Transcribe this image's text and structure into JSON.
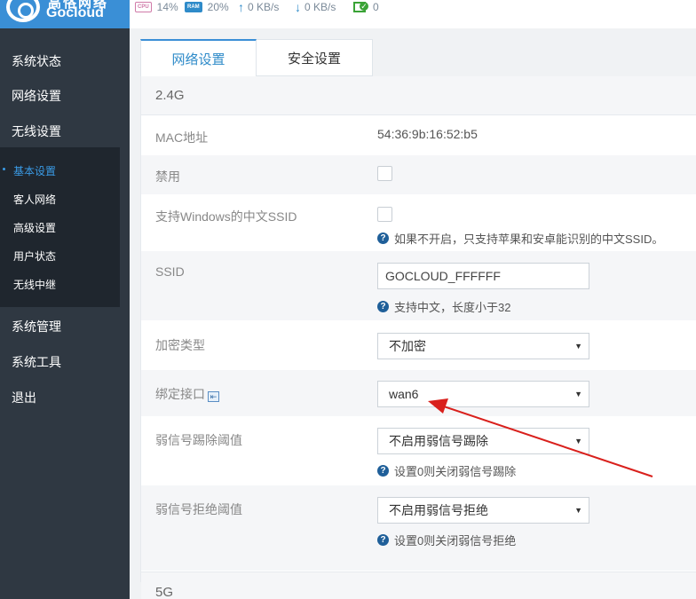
{
  "logo": {
    "cn": "高恪网络",
    "en": "Gocloud"
  },
  "status": {
    "cpu_chip": "CPU",
    "cpu": "14%",
    "ram_chip": "RAM",
    "ram": "20%",
    "up": "0 KB/s",
    "down": "0 KB/s",
    "devices": "0"
  },
  "sidebar": {
    "items": [
      "系统状态",
      "网络设置",
      "无线设置"
    ],
    "submenu": [
      "基本设置",
      "客人网络",
      "高级设置",
      "用户状态",
      "无线中继"
    ],
    "items_after": [
      "系统管理",
      "系统工具",
      "退出"
    ]
  },
  "tabs": [
    "网络设置",
    "安全设置"
  ],
  "form": {
    "section_24g": "2.4G",
    "mac_label": "MAC地址",
    "mac_value": "54:36:9b:16:52:b5",
    "disable_label": "禁用",
    "cn_ssid_label": "支持Windows的中文SSID",
    "cn_ssid_hint": "如果不开启，只支持苹果和安卓能识别的中文SSID。",
    "ssid_label": "SSID",
    "ssid_value": "GOCLOUD_FFFFFF",
    "ssid_hint": "支持中文，长度小于32",
    "encrypt_label": "加密类型",
    "encrypt_value": "不加密",
    "bind_label": "绑定接口",
    "bind_value": "wan6",
    "weak_kick_label": "弱信号踢除阈值",
    "weak_kick_value": "不启用弱信号踢除",
    "weak_kick_hint": "设置0则关闭弱信号踢除",
    "weak_reject_label": "弱信号拒绝阈值",
    "weak_reject_value": "不启用弱信号拒绝",
    "weak_reject_hint": "设置0则关闭弱信号拒绝",
    "section_5g": "5G"
  },
  "colors": {
    "accent": "#3a8fd6",
    "sidebar": "#2f3842",
    "submenu": "#1f262e",
    "annotation_arrow": "#d9201c"
  },
  "icons": {
    "help": "question-circle-icon",
    "up": "arrow-up-icon",
    "down": "arrow-down-icon",
    "device": "device-check-icon",
    "bind": "interface-link-icon"
  }
}
